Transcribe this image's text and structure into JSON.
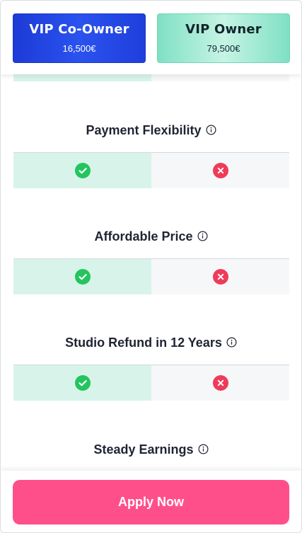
{
  "plans": {
    "coowner": {
      "name": "VIP Co-Owner",
      "price": "16,500€"
    },
    "owner": {
      "name": "VIP Owner",
      "price": "79,500€"
    }
  },
  "features": [
    {
      "title": "Payment Flexibility",
      "coowner": "check",
      "owner": "cross"
    },
    {
      "title": "Affordable Price",
      "coowner": "check",
      "owner": "cross"
    },
    {
      "title": "Studio Refund in 12 Years",
      "coowner": "check",
      "owner": "cross"
    },
    {
      "title": "Steady Earnings"
    }
  ],
  "footer": {
    "apply_label": "Apply Now"
  },
  "colors": {
    "coowner_card": "#1d3bd6",
    "owner_card": "#7fe0c3",
    "check": "#22c55e",
    "cross": "#ef3b5a",
    "apply_button": "#ff4f8a"
  },
  "icons": {
    "info": "info-circle-icon",
    "check": "check-circle-icon",
    "cross": "x-circle-icon"
  }
}
